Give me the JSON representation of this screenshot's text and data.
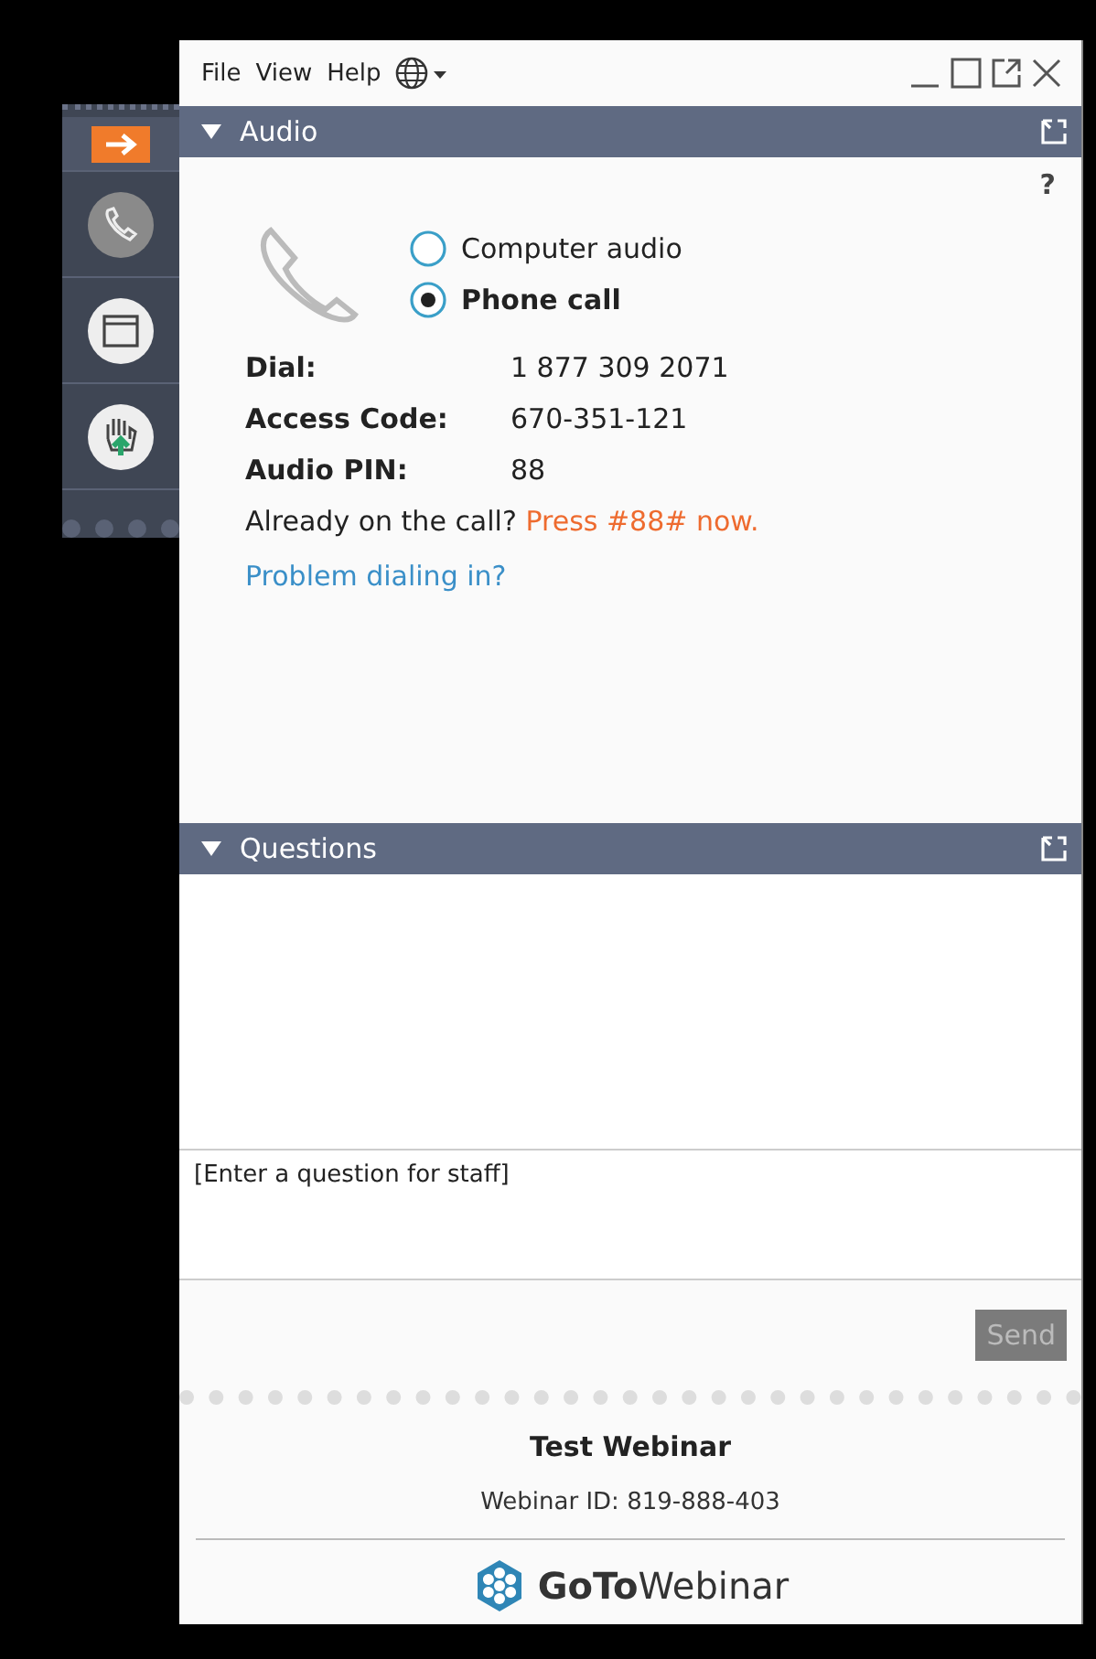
{
  "menu": [
    "File",
    "View",
    "Help"
  ],
  "sidebar": {
    "items": [
      {
        "kind": "arrow",
        "selected": true
      },
      {
        "kind": "phone",
        "selected": false
      },
      {
        "kind": "window",
        "selected": false
      },
      {
        "kind": "hand",
        "selected": false
      }
    ]
  },
  "audio": {
    "title": "Audio",
    "help": "?",
    "options": [
      {
        "label": "Computer audio",
        "selected": false
      },
      {
        "label": "Phone call",
        "selected": true
      }
    ],
    "details": [
      {
        "label": "Dial:",
        "value": "1 877 309 2071"
      },
      {
        "label": "Access Code:",
        "value": "670-351-121"
      },
      {
        "label": "Audio PIN:",
        "value": "88"
      }
    ],
    "already": "Already on the call?",
    "press": "Press #88# now.",
    "problem_link": "Problem dialing in?"
  },
  "questions": {
    "title": "Questions",
    "placeholder": "[Enter a question for staff]",
    "send": {
      "label": "Send",
      "disabled": true
    }
  },
  "footer": {
    "title": "Test Webinar",
    "webinar_id": "Webinar ID: 819-888-403",
    "logo": "**GoTo**Webinar"
  }
}
